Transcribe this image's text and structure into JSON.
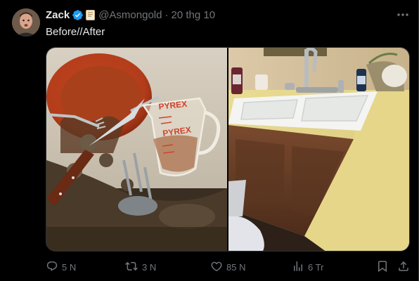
{
  "tweet": {
    "author_name": "Zack",
    "handle": "@Asmongold",
    "separator": "·",
    "date": "20 thg 10",
    "text": "Before//After"
  },
  "images": {
    "before": {
      "watermark": "PYREX"
    },
    "after": {}
  },
  "stats": {
    "replies": "5 N",
    "retweets": "3 N",
    "likes": "85 N",
    "views": "6 Tr"
  },
  "icons": {
    "verified": "verified-badge-icon",
    "affiliate": "affiliate-badge-icon",
    "more": "more-icon",
    "reply": "reply-icon",
    "retweet": "retweet-icon",
    "like": "like-icon",
    "views": "views-icon",
    "bookmark": "bookmark-icon",
    "share": "share-icon"
  },
  "colors": {
    "background": "#000000",
    "text_primary": "#e7e9ea",
    "text_secondary": "#71767b",
    "verified_blue": "#1d9bf0"
  }
}
